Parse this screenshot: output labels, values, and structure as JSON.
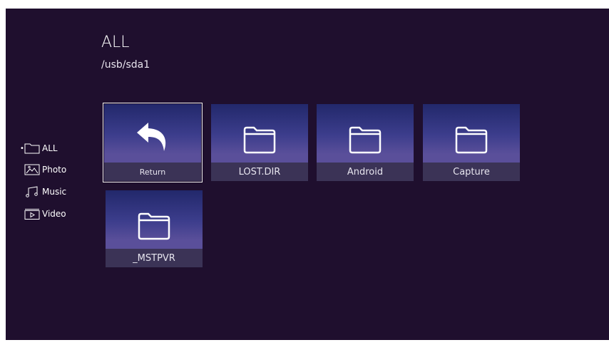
{
  "header": {
    "title": "ALL",
    "path": "/usb/sda1"
  },
  "sidebar": {
    "items": [
      {
        "label": "ALL",
        "icon": "folder-icon",
        "selected": true
      },
      {
        "label": "Photo",
        "icon": "photo-icon",
        "selected": false
      },
      {
        "label": "Music",
        "icon": "music-icon",
        "selected": false
      },
      {
        "label": "Video",
        "icon": "video-icon",
        "selected": false
      }
    ]
  },
  "grid": {
    "items": [
      {
        "label": "Return",
        "icon": "return-arrow-icon",
        "selected": true
      },
      {
        "label": "LOST.DIR",
        "icon": "folder-icon",
        "selected": false
      },
      {
        "label": "Android",
        "icon": "folder-icon",
        "selected": false
      },
      {
        "label": "Capture",
        "icon": "folder-icon",
        "selected": false
      },
      {
        "label": "_MSTPVR",
        "icon": "folder-icon",
        "selected": false
      }
    ]
  },
  "colors": {
    "background": "#1f0f2e",
    "tile_top": "#22286b",
    "tile_bottom": "#5a4f9a",
    "label_bar": "#3b3356"
  }
}
